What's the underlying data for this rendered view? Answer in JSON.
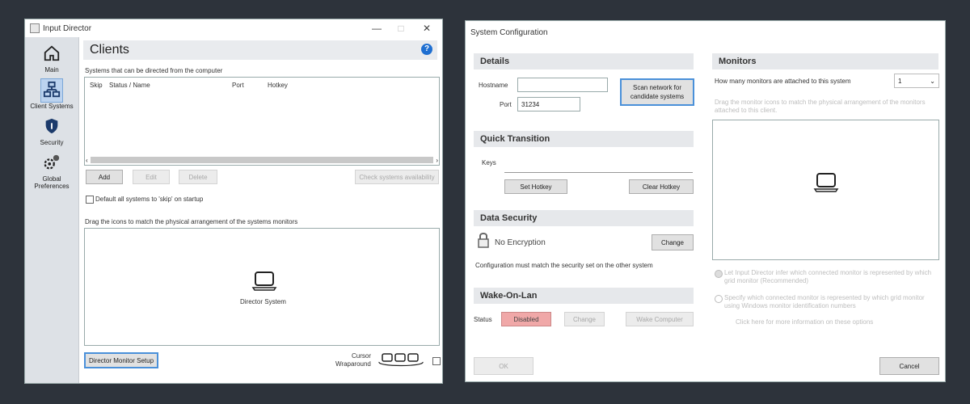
{
  "left_window": {
    "title": "Input Director",
    "controls": {
      "minimize": "—",
      "maximize": "□",
      "close": "✕"
    },
    "sidebar": [
      {
        "label": "Main",
        "icon": "home-icon"
      },
      {
        "label": "Client Systems",
        "icon": "network-icon"
      },
      {
        "label": "Security",
        "icon": "shield-icon"
      },
      {
        "label": "Global Preferences",
        "icon": "gears-icon"
      }
    ],
    "panel_title": "Clients",
    "help_glyph": "?",
    "list_caption": "Systems that can be directed from the computer",
    "columns": [
      "Skip",
      "Status / Name",
      "Port",
      "Hotkey"
    ],
    "buttons": {
      "add": "Add",
      "edit": "Edit",
      "delete": "Delete",
      "check": "Check systems availability",
      "monitor_setup": "Director Monitor Setup"
    },
    "default_skip_label": "Default all systems to 'skip' on startup",
    "arrange_caption": "Drag the icons to match the physical arrangement of the systems monitors",
    "director_label": "Director System",
    "cursor_wrap_line1": "Cursor",
    "cursor_wrap_line2": "Wraparound"
  },
  "right_window": {
    "title": "System Configuration",
    "details": {
      "header": "Details",
      "hostname_label": "Hostname",
      "hostname_value": "",
      "port_label": "Port",
      "port_value": "31234",
      "scan_button": "Scan network for candidate systems"
    },
    "quick": {
      "header": "Quick Transition",
      "keys_label": "Keys",
      "set_hotkey": "Set Hotkey",
      "clear_hotkey": "Clear Hotkey"
    },
    "security": {
      "header": "Data Security",
      "status": "No Encryption",
      "change": "Change",
      "note": "Configuration must match the security set on the other system"
    },
    "wol": {
      "header": "Wake-On-Lan",
      "status_label": "Status",
      "status_value": "Disabled",
      "change": "Change",
      "wake": "Wake Computer"
    },
    "monitors": {
      "header": "Monitors",
      "count_label": "How many monitors are attached to this system",
      "count_value": "1",
      "drag_hint": "Drag the monitor icons to match the physical arrangement of the monitors attached to this client.",
      "radio1": "Let Input Director infer which connected monitor is represented by which grid monitor (Recommended)",
      "radio2": "Specify which connected monitor is represented by which grid monitor using Windows monitor identification numbers",
      "info_link": "Click here for more information on these options"
    },
    "ok": "OK",
    "cancel": "Cancel"
  }
}
